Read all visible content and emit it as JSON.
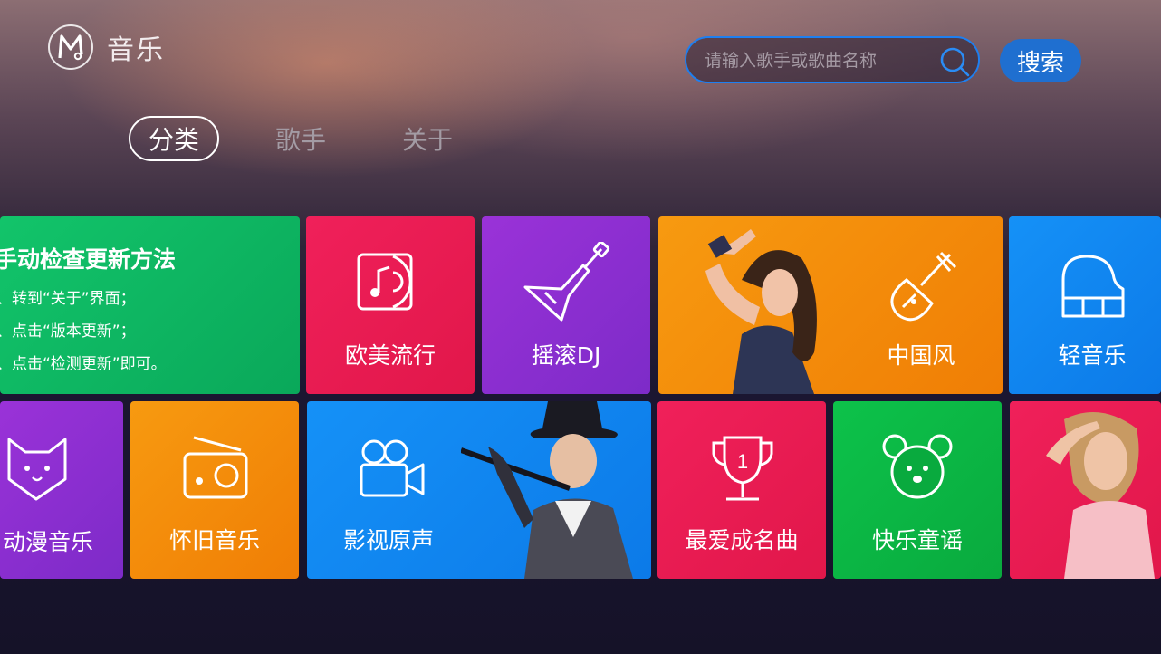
{
  "header": {
    "app_title": "音乐",
    "logo_icon": "music-logo-icon",
    "search": {
      "placeholder": "请输入歌手或歌曲名称",
      "value": ""
    },
    "search_button_label": "搜索"
  },
  "tabs": [
    {
      "label": "分类",
      "active": true
    },
    {
      "label": "歌手",
      "active": false
    },
    {
      "label": "关于",
      "active": false
    }
  ],
  "notice": {
    "title": "手动检查更新方法",
    "steps": [
      "、转到“关于”界面；",
      "、点击“版本更新”；",
      "、点击“检测更新”即可。"
    ]
  },
  "categories": {
    "row1": [
      {
        "label": "欧美流行",
        "icon": "vinyl-record-icon",
        "color": "#e91a50"
      },
      {
        "label": "摇滚DJ",
        "icon": "electric-guitar-icon",
        "color": "#8a2fd0"
      },
      {
        "label": "中国风",
        "icon": "pipa-icon",
        "color": "#f38c08"
      },
      {
        "label": "轻音乐",
        "icon": "piano-icon",
        "color": "#1187f0"
      }
    ],
    "row2": [
      {
        "label": "动漫音乐",
        "icon": "cat-face-icon",
        "color": "#8a2fd0"
      },
      {
        "label": "怀旧音乐",
        "icon": "radio-icon",
        "color": "#f38c08"
      },
      {
        "label": "影视原声",
        "icon": "movie-camera-icon",
        "color": "#1187f0"
      },
      {
        "label": "最爱成名曲",
        "icon": "trophy-icon",
        "color": "#e91a50"
      },
      {
        "label": "快乐童谣",
        "icon": "bear-face-icon",
        "color": "#0cbb45"
      }
    ],
    "trophy_number": "1"
  }
}
